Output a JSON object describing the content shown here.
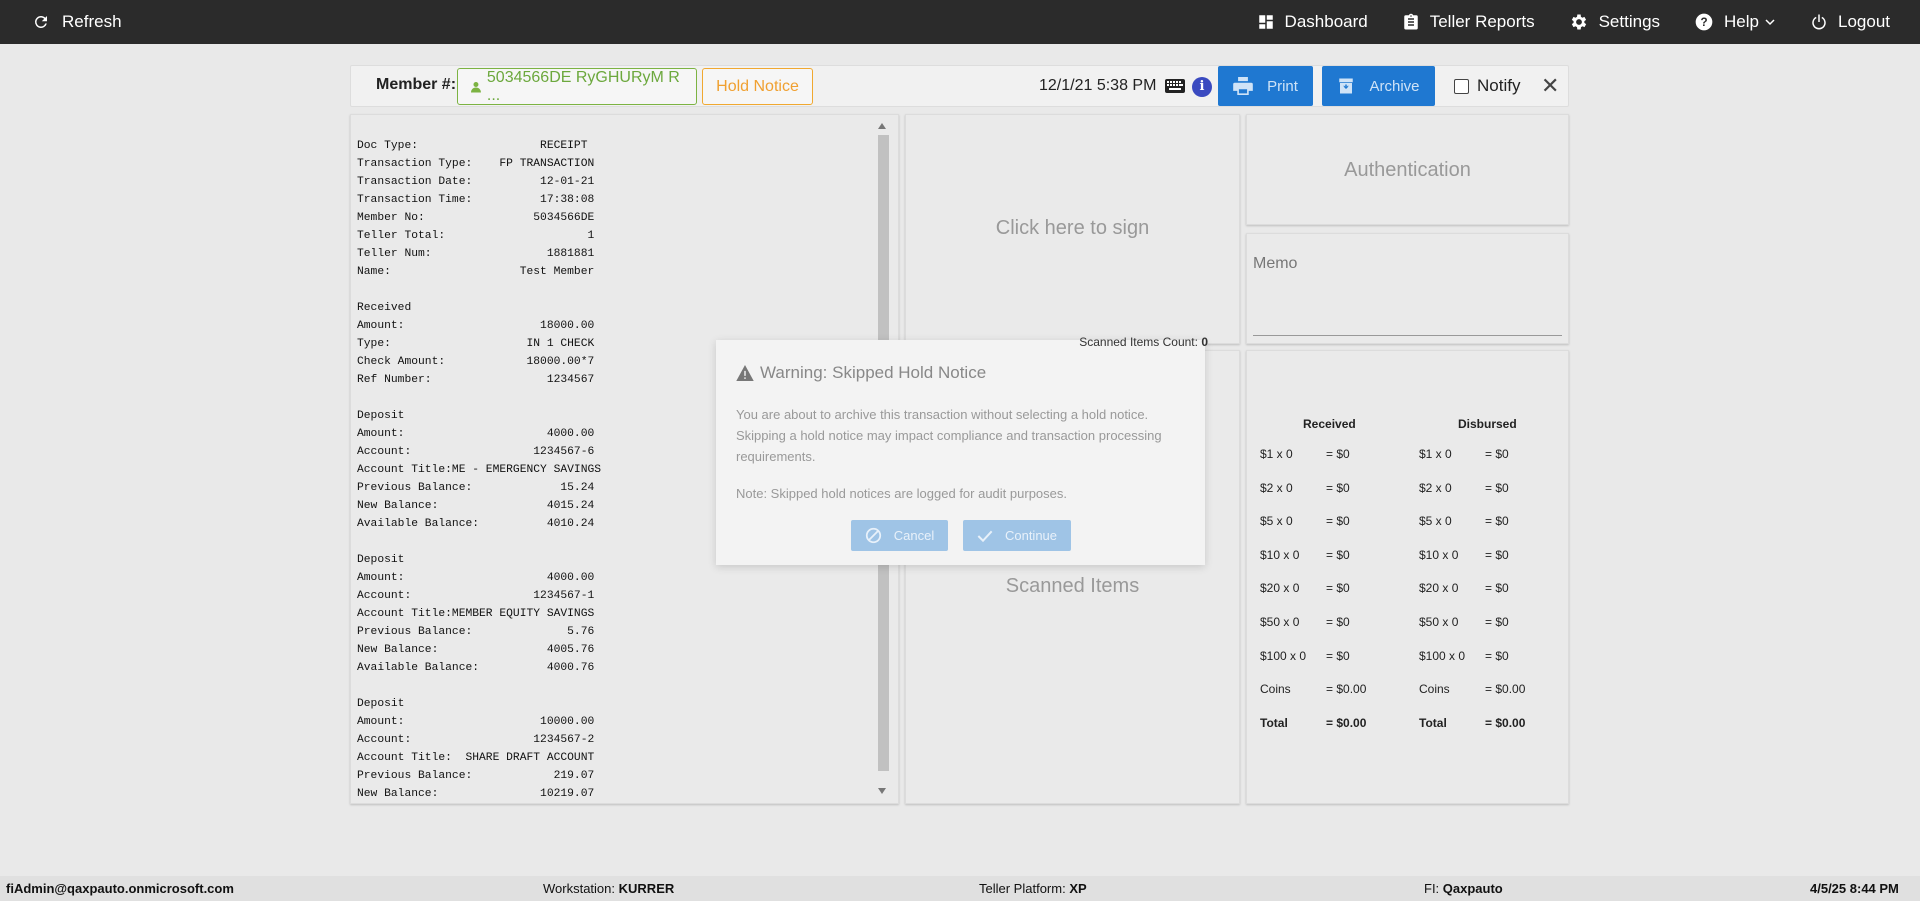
{
  "topbar": {
    "refresh_label": "Refresh",
    "dashboard_label": "Dashboard",
    "teller_reports_label": "Teller Reports",
    "settings_label": "Settings",
    "help_label": "Help",
    "logout_label": "Logout"
  },
  "memberbar": {
    "member_label": "Member #:",
    "member_value": "5034566DE RyGHURyM R ...",
    "hold_notice_label": "Hold Notice",
    "datetime": "12/1/21 5:38 PM",
    "print_label": "Print",
    "archive_label": "Archive",
    "notify_label": "Notify",
    "notify_checked": false
  },
  "receipt": {
    "lines": [
      "Doc Type:                  RECEIPT",
      "Transaction Type:    FP TRANSACTION",
      "Transaction Date:          12-01-21",
      "Transaction Time:          17:38:08",
      "Member No:                5034566DE",
      "Teller Total:                     1",
      "Teller Num:                 1881881",
      "Name:                   Test Member",
      "",
      "Received",
      "Amount:                    18000.00",
      "Type:                    IN 1 CHECK",
      "Check Amount:            18000.00*7",
      "Ref Number:                 1234567",
      "",
      "Deposit",
      "Amount:                     4000.00",
      "Account:                  1234567-6",
      "Account Title:ME - EMERGENCY SAVINGS",
      "Previous Balance:             15.24",
      "New Balance:                4015.24",
      "Available Balance:          4010.24",
      "",
      "Deposit",
      "Amount:                     4000.00",
      "Account:                  1234567-1",
      "Account Title:MEMBER EQUITY SAVINGS",
      "Previous Balance:              5.76",
      "New Balance:                4005.76",
      "Available Balance:          4000.76",
      "",
      "Deposit",
      "Amount:                    10000.00",
      "Account:                  1234567-2",
      "Account Title:  SHARE DRAFT ACCOUNT",
      "Previous Balance:            219.07",
      "New Balance:               10219.07"
    ]
  },
  "sign_panel": {
    "label": "Click here to sign"
  },
  "scanned_panel": {
    "label": "Scanned Items"
  },
  "auth_panel": {
    "label": "Authentication"
  },
  "memo_panel": {
    "label": "Memo"
  },
  "cash": {
    "received_header": "Received",
    "disbursed_header": "Disbursed",
    "rows": [
      {
        "denom": "$1 x 0",
        "value": "= $0"
      },
      {
        "denom": "$2 x 0",
        "value": "= $0"
      },
      {
        "denom": "$5 x 0",
        "value": "= $0"
      },
      {
        "denom": "$10 x 0",
        "value": "= $0"
      },
      {
        "denom": "$20 x 0",
        "value": "= $0"
      },
      {
        "denom": "$50 x 0",
        "value": "= $0"
      },
      {
        "denom": "$100 x 0",
        "value": "= $0"
      },
      {
        "denom": "Coins",
        "value": "= $0.00"
      },
      {
        "denom": "Total",
        "value": "= $0.00"
      }
    ]
  },
  "modal": {
    "scanned_count_label": "Scanned Items Count:",
    "scanned_count_value": "0",
    "title": "Warning: Skipped Hold Notice",
    "message": "You are about to archive this transaction without selecting a hold notice. Skipping a hold notice may impact compliance and transaction processing requirements.",
    "note": "Note: Skipped hold notices are logged for audit purposes.",
    "cancel_label": "Cancel",
    "continue_label": "Continue"
  },
  "footer": {
    "user": "fiAdmin@qaxpauto.onmicrosoft.com",
    "workstation_label": "Workstation:",
    "workstation_value": "KURRER",
    "platform_label": "Teller Platform:",
    "platform_value": "XP",
    "fi_label": "FI:",
    "fi_value": "Qaxpauto",
    "datetime": "4/5/25 8:44 PM"
  }
}
